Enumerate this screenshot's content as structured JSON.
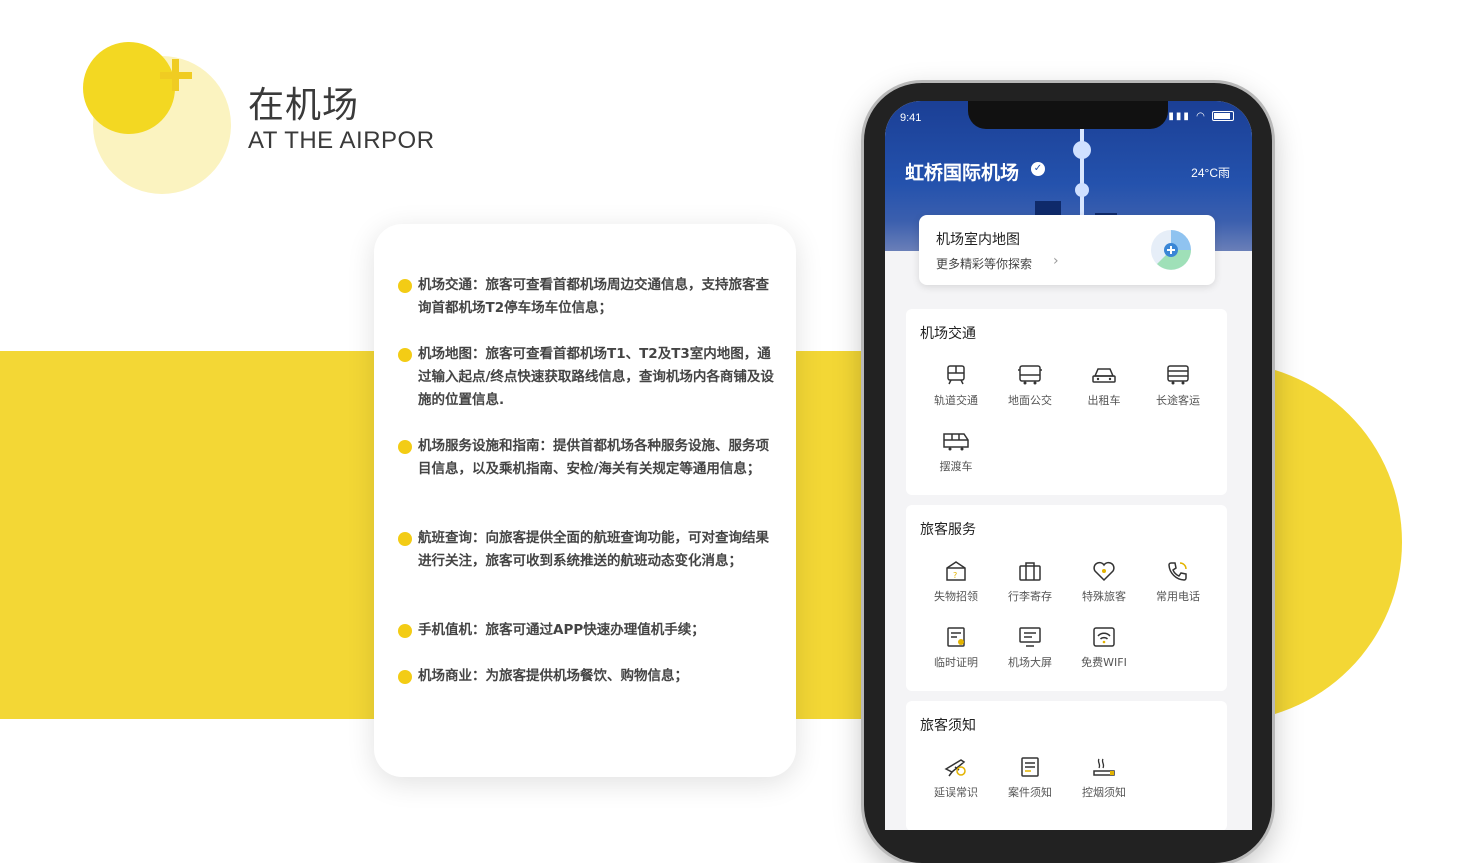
{
  "header": {
    "title_cn": "在机场",
    "title_en": "AT THE AIRPOR"
  },
  "colors": {
    "accent_yellow": "#f3d735",
    "brand_blue": "#2452ad"
  },
  "features": [
    {
      "text": "机场交通：旅客可查看首都机场周边交通信息，支持旅客查询首都机场T2停车场车位信息；"
    },
    {
      "text": "机场地图：旅客可查看首都机场T1、T2及T3室内地图，通过输入起点/终点快速获取路线信息，查询机场内各商铺及设施的位置信息."
    },
    {
      "text": "机场服务设施和指南：提供首都机场各种服务设施、服务项目信息，以及乘机指南、安检/海关有关规定等通用信息；"
    },
    {
      "text": "航班查询：向旅客提供全面的航班查询功能，可对查询结果进行关注，旅客可收到系统推送的航班动态变化消息；"
    },
    {
      "text": "手机值机：旅客可通过APP快速办理值机手续；"
    },
    {
      "text": "机场商业：为旅客提供机场餐饮、购物信息；"
    }
  ],
  "phone": {
    "status_time": "9:41",
    "airport_name": "虹桥国际机场",
    "weather": "24°C雨",
    "map_card": {
      "title": "机场室内地图",
      "subtitle": "更多精彩等你探索"
    },
    "sections": [
      {
        "title": "机场交通",
        "items": [
          {
            "label": "轨道交通",
            "icon": "train-icon"
          },
          {
            "label": "地面公交",
            "icon": "bus-icon"
          },
          {
            "label": "出租车",
            "icon": "taxi-icon"
          },
          {
            "label": "长途客运",
            "icon": "coach-icon"
          },
          {
            "label": "摆渡车",
            "icon": "shuttle-icon"
          }
        ]
      },
      {
        "title": "旅客服务",
        "items": [
          {
            "label": "失物招领",
            "icon": "lost-found-icon"
          },
          {
            "label": "行李寄存",
            "icon": "luggage-icon"
          },
          {
            "label": "特殊旅客",
            "icon": "special-passenger-icon"
          },
          {
            "label": "常用电话",
            "icon": "phone-icon"
          },
          {
            "label": "临时证明",
            "icon": "certificate-icon"
          },
          {
            "label": "机场大屏",
            "icon": "screen-icon"
          },
          {
            "label": "免费WIFI",
            "icon": "wifi-icon"
          }
        ]
      },
      {
        "title": "旅客须知",
        "items": [
          {
            "label": "延误常识",
            "icon": "delay-icon"
          },
          {
            "label": "案件须知",
            "icon": "case-icon"
          },
          {
            "label": "控烟须知",
            "icon": "no-smoking-icon"
          }
        ]
      }
    ]
  }
}
